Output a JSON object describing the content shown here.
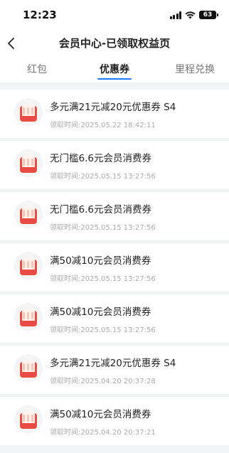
{
  "status_bar": {
    "time": "12:23",
    "battery": "63"
  },
  "nav": {
    "title": "会员中心-已领取权益页"
  },
  "tabs": [
    {
      "label": "红包",
      "active": false
    },
    {
      "label": "优惠券",
      "active": true
    },
    {
      "label": "里程兑换",
      "active": false
    }
  ],
  "coupons": [
    {
      "title": "多元满21元减20元优惠券 S4",
      "time": "领取时间:2025.05.22 18:42:11"
    },
    {
      "title": "无门槛6.6元会员消费券",
      "time": "领取时间:2025.05.15 13:27:56"
    },
    {
      "title": "无门槛6.6元会员消费券",
      "time": "领取时间:2025.05.15 13:27:56"
    },
    {
      "title": "满50减10元会员消费券",
      "time": "领取时间:2025.05.15 13:27:56"
    },
    {
      "title": "满50减10元会员消费券",
      "time": "领取时间:2025.05.15 13:27:56"
    },
    {
      "title": "多元满21元减20元优惠券 S4",
      "time": "领取时间:2025.04.20 20:37:28"
    },
    {
      "title": "满50减10元会员消费券",
      "time": "领取时间:2025.04.20 20:37:21"
    }
  ],
  "colors": {
    "accent": "#1e78ff",
    "coupon_red": "#e94a43"
  },
  "icons": {
    "back": "chevron-left-icon",
    "coupon": "coupon-bag-icon"
  }
}
